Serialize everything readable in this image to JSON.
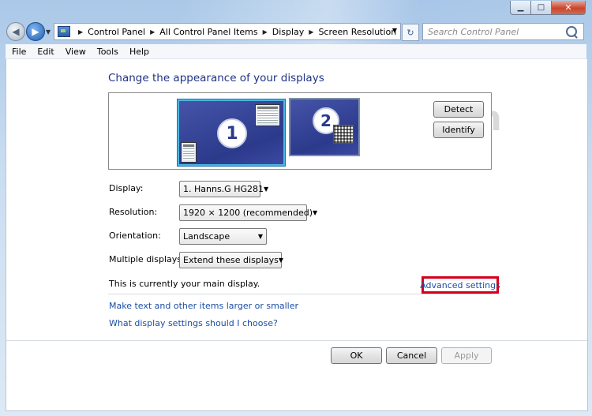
{
  "window": {
    "caption": {
      "minimize": "▁",
      "maximize": "□",
      "close": "✕"
    }
  },
  "navigation": {
    "back_icon": "◀",
    "forward_icon": "▶",
    "breadcrumb": [
      "Control Panel",
      "All Control Panel Items",
      "Display",
      "Screen Resolution"
    ],
    "refresh_icon": "↻",
    "search_placeholder": "Search Control Panel"
  },
  "menu": [
    "File",
    "Edit",
    "View",
    "Tools",
    "Help"
  ],
  "watermark": "SevenForums.com",
  "page": {
    "heading": "Change the appearance of your displays",
    "monitors": [
      {
        "number": "1",
        "selected": true
      },
      {
        "number": "2",
        "selected": false
      }
    ],
    "detect_label": "Detect",
    "identify_label": "Identify",
    "fields": {
      "display": {
        "label": "Display:",
        "value": "1. Hanns.G HG281"
      },
      "resolution": {
        "label": "Resolution:",
        "value": "1920 × 1200 (recommended)"
      },
      "orientation": {
        "label": "Orientation:",
        "value": "Landscape"
      },
      "multiple": {
        "label": "Multiple displays:",
        "value": "Extend these displays"
      }
    },
    "main_display_note": "This is currently your main display.",
    "advanced_settings": "Advanced settings",
    "links": {
      "text_size": "Make text and other items larger or smaller",
      "which_settings": "What display settings should I choose?"
    }
  },
  "buttons": {
    "ok": "OK",
    "cancel": "Cancel",
    "apply": "Apply"
  },
  "colors": {
    "link": "#1a4ea5",
    "highlight_box": "#d6001c",
    "heading": "#1e3287"
  }
}
